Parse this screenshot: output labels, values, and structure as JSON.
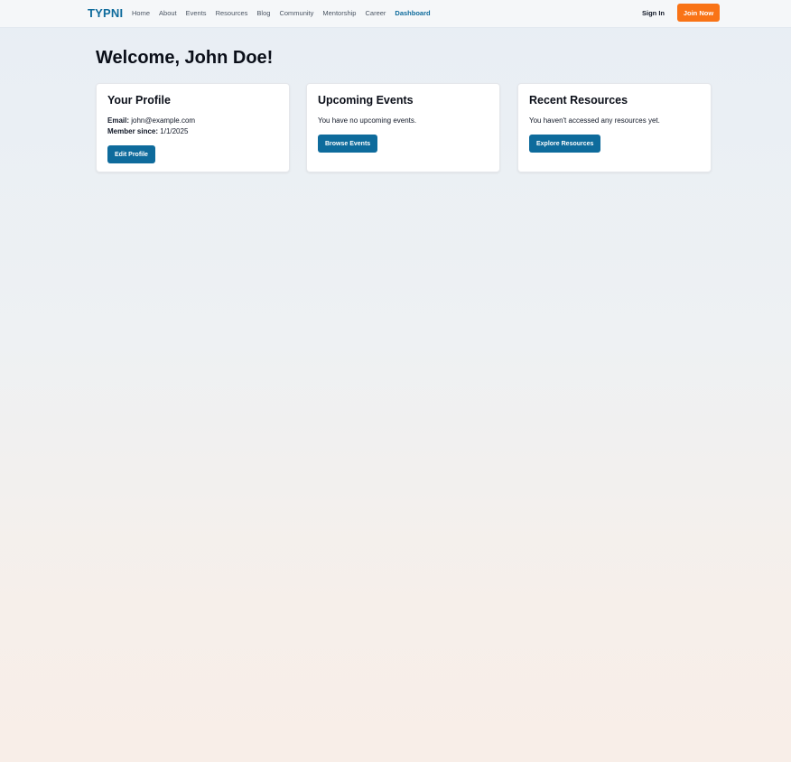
{
  "navbar": {
    "brand": "TYPNI",
    "links": [
      "Home",
      "About",
      "Events",
      "Resources",
      "Blog",
      "Community",
      "Mentorship",
      "Career",
      "Dashboard"
    ],
    "active_link": "Dashboard",
    "sign_in": "Sign In",
    "join_now": "Join Now"
  },
  "colors": {
    "brand": "#0e6b9c",
    "accent": "#f97316"
  },
  "dashboard": {
    "welcome": "Welcome, John Doe!",
    "profile": {
      "title": "Your Profile",
      "email_label": "Email:",
      "email_value": "john@example.com",
      "member_label": "Member since:",
      "member_value": "1/1/2025",
      "button": "Edit Profile"
    },
    "events": {
      "title": "Upcoming Events",
      "message": "You have no upcoming events.",
      "button": "Browse Events"
    },
    "resources": {
      "title": "Recent Resources",
      "message": "You haven't accessed any resources yet.",
      "button": "Explore Resources"
    }
  }
}
